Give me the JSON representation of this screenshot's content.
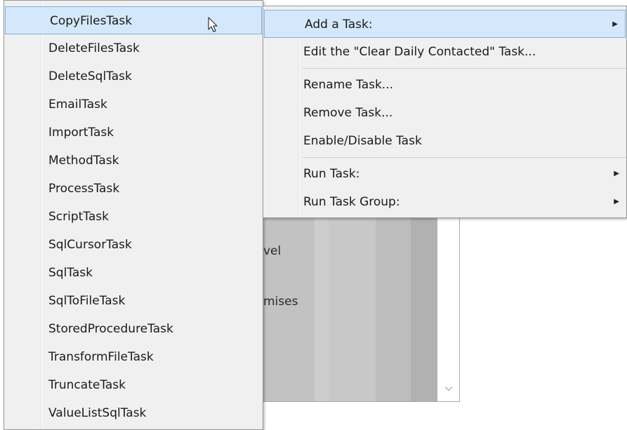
{
  "background_window": {
    "partial_text_1": "vel",
    "partial_text_2": "mises",
    "scroll_arrow": "⌵"
  },
  "task_types_menu": {
    "items": [
      {
        "label": "CopyFilesTask",
        "highlighted": true
      },
      {
        "label": "DeleteFilesTask"
      },
      {
        "label": "DeleteSqlTask"
      },
      {
        "label": "EmailTask"
      },
      {
        "label": "ImportTask"
      },
      {
        "label": "MethodTask"
      },
      {
        "label": "ProcessTask"
      },
      {
        "label": "ScriptTask"
      },
      {
        "label": "SqlCursorTask"
      },
      {
        "label": "SqlTask"
      },
      {
        "label": "SqlToFileTask"
      },
      {
        "label": "StoredProcedureTask"
      },
      {
        "label": "TransformFileTask"
      },
      {
        "label": "TruncateTask"
      },
      {
        "label": "ValueListSqlTask"
      }
    ]
  },
  "context_menu": {
    "add_task": "Add a Task:",
    "edit_task": "Edit the \"Clear Daily Contacted\" Task...",
    "rename_task": "Rename Task...",
    "remove_task": "Remove Task...",
    "enable_disable_task": "Enable/Disable Task",
    "run_task": "Run Task:",
    "run_task_group": "Run Task Group:",
    "submenu_arrow": "▶"
  },
  "colors": {
    "menu_background": "#f0f0f0",
    "highlight_background": "#d5e8fb",
    "highlight_border": "#7aaee8"
  }
}
